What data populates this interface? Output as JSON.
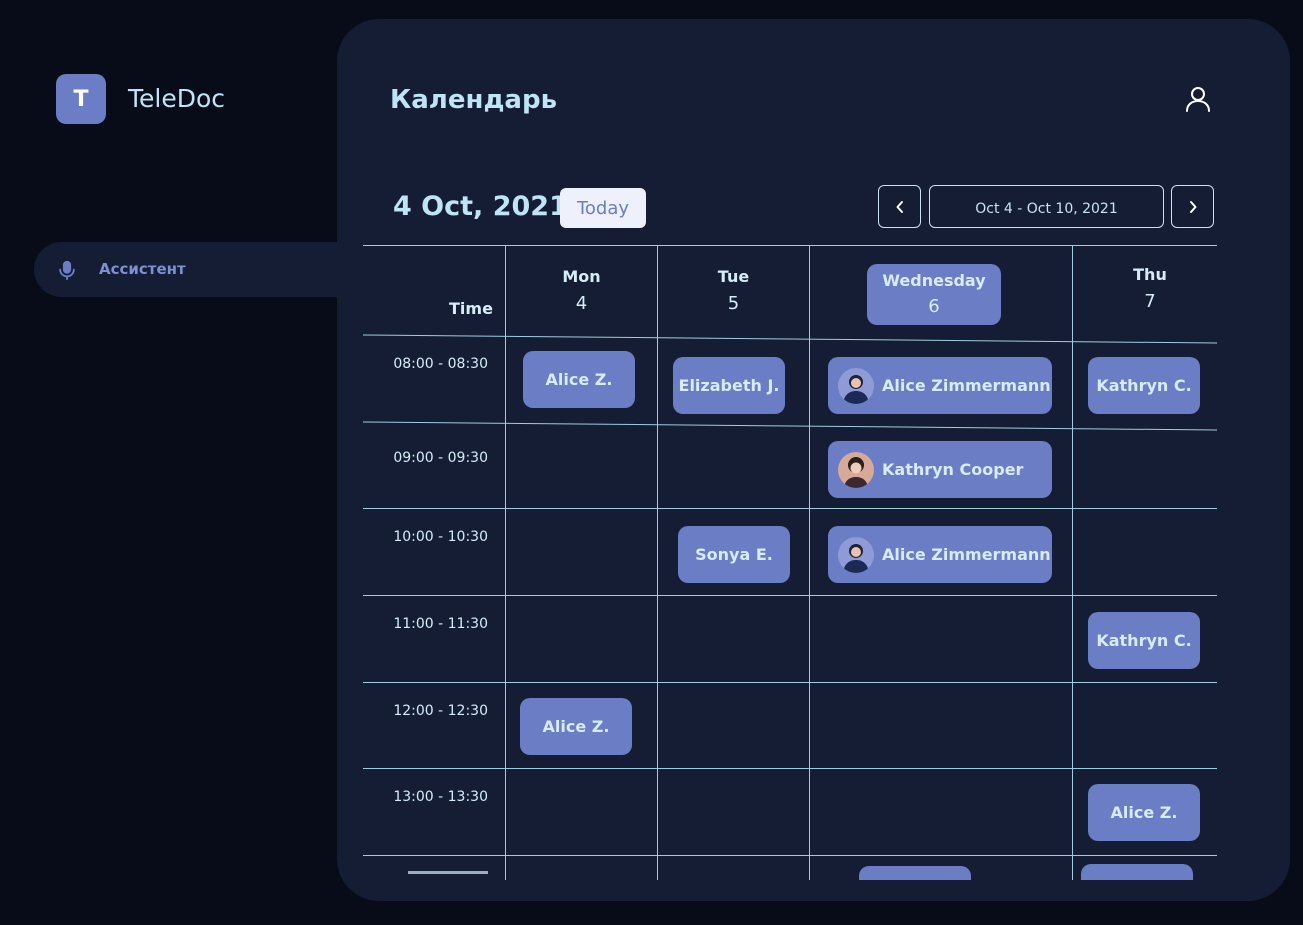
{
  "app": {
    "logo_letter": "T",
    "name": "TeleDoc"
  },
  "sidebar": {
    "items": [
      {
        "label": "Ассистент",
        "icon": "microphone-icon"
      }
    ]
  },
  "header": {
    "title": "Календарь"
  },
  "toolbar": {
    "current_date": "4 Oct, 2021",
    "today_label": "Today",
    "prev_label": "‹",
    "next_label": "›",
    "range_label": "Oct 4 - Oct 10, 2021"
  },
  "calendar": {
    "time_header": "Time",
    "days": [
      {
        "name": "Mon",
        "num": "4"
      },
      {
        "name": "Tue",
        "num": "5"
      },
      {
        "name": "Wednesday",
        "num": "6",
        "active": true
      },
      {
        "name": "Thu",
        "num": "7"
      }
    ],
    "times": [
      "08:00 - 08:30",
      "09:00 - 09:30",
      "10:00 - 10:30",
      "11:00 - 11:30",
      "12:00 - 12:30",
      "13:00 - 13:30"
    ],
    "events": [
      {
        "label": "Alice Z."
      },
      {
        "label": "Elizabeth J."
      },
      {
        "label": "Alice Zimmermann"
      },
      {
        "label": "Kathryn C."
      },
      {
        "label": "Kathryn Cooper"
      },
      {
        "label": "Sonya E."
      },
      {
        "label": "Alice Zimmermann"
      },
      {
        "label": "Kathryn C."
      },
      {
        "label": "Alice Z."
      },
      {
        "label": "Alice Z."
      }
    ]
  },
  "colors": {
    "background": "#080c18",
    "panel": "#141d33",
    "accent": "#6b7dc4",
    "text_light": "#bfe4f6",
    "grid_line": "#9fcde0"
  }
}
